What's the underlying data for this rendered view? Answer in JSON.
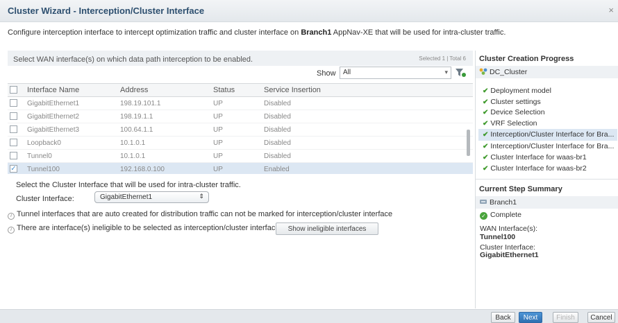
{
  "window": {
    "title": "Cluster Wizard - Interception/Cluster Interface",
    "close_glyph": "×"
  },
  "description": {
    "prefix": "Configure interception interface to intercept optimization traffic and cluster interface on ",
    "device": "Branch1",
    "suffix": " AppNav-XE that will be used for intra-cluster traffic."
  },
  "wan_panel": {
    "prompt": "Select WAN interface(s) on which data path interception to be enabled.",
    "counts": "Selected 1 | Total 6",
    "show_label": "Show",
    "show_value": "All",
    "columns": [
      "Interface Name",
      "Address",
      "Status",
      "Service Insertion"
    ],
    "rows": [
      {
        "name": "GigabitEthernet1",
        "address": "198.19.101.1",
        "status": "UP",
        "service": "Disabled",
        "checked": false
      },
      {
        "name": "GigabitEthernet2",
        "address": "198.19.1.1",
        "status": "UP",
        "service": "Disabled",
        "checked": false
      },
      {
        "name": "GigabitEthernet3",
        "address": "100.64.1.1",
        "status": "UP",
        "service": "Disabled",
        "checked": false
      },
      {
        "name": "Loopback0",
        "address": "10.1.0.1",
        "status": "UP",
        "service": "Disabled",
        "checked": false
      },
      {
        "name": "Tunnel0",
        "address": "10.1.0.1",
        "status": "UP",
        "service": "Disabled",
        "checked": false
      },
      {
        "name": "Tunnel100",
        "address": "192.168.0.100",
        "status": "UP",
        "service": "Enabled",
        "checked": true
      }
    ]
  },
  "cluster_interface": {
    "prompt": "Select the Cluster Interface that will be used for intra-cluster traffic.",
    "label": "Cluster Interface:",
    "value": "GigabitEthernet1",
    "note1": "Tunnel interfaces that are auto created for distribution traffic can not be marked for interception/cluster interface",
    "note2": "There are interface(s) ineligible to be selected as interception/cluster interface",
    "ineligible_button": "Show ineligible interfaces"
  },
  "progress": {
    "title": "Cluster Creation Progress",
    "cluster_name": "DC_Cluster",
    "steps": [
      {
        "label": "Deployment model",
        "active": false
      },
      {
        "label": "Cluster settings",
        "active": false
      },
      {
        "label": "Device Selection",
        "active": false
      },
      {
        "label": "VRF Selection",
        "active": false
      },
      {
        "label": "Interception/Cluster Interface for Bra...",
        "active": true
      },
      {
        "label": "Interception/Cluster Interface for Bra...",
        "active": false
      },
      {
        "label": "Cluster Interface for waas-br1",
        "active": false
      },
      {
        "label": "Cluster Interface for waas-br2",
        "active": false
      }
    ]
  },
  "summary": {
    "title": "Current Step Summary",
    "device": "Branch1",
    "status": "Complete",
    "wan_label": "WAN Interface(s):",
    "wan_value": "Tunnel100",
    "cluster_label": "Cluster Interface:",
    "cluster_value": "GigabitEthernet1"
  },
  "footer": {
    "back": "Back",
    "next": "Next",
    "finish": "Finish",
    "cancel": "Cancel"
  },
  "colors": {
    "accent": "#2f6fb0",
    "selected_row": "#dce7f3",
    "success": "#49a43c"
  }
}
